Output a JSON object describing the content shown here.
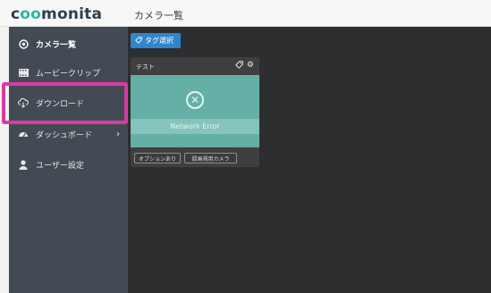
{
  "header": {
    "logo_prefix": "c",
    "logo_oo": "oo",
    "logo_suffix": "monita",
    "page_title": "カメラ一覧"
  },
  "sidebar": {
    "items": [
      {
        "label": "カメラ一覧",
        "icon": "camera-circle-icon",
        "active": true
      },
      {
        "label": "ムービークリップ",
        "icon": "film-icon"
      },
      {
        "label": "ダウンロード",
        "icon": "cloud-download-icon"
      },
      {
        "label": "ダッシュボード",
        "icon": "dashboard-icon",
        "chevron": "›"
      },
      {
        "label": "ユーザー設定",
        "icon": "user-icon"
      }
    ]
  },
  "toolbar": {
    "tag_select_label": "タグ選択",
    "tag_icon": "⌂"
  },
  "camera_card": {
    "title": "テスト",
    "tag_icon": "◇",
    "gear_icon": "⚙",
    "error_symbol": "✕",
    "error_text": "Network Error",
    "chips": [
      "オプションあり",
      "録画視用カメラ"
    ]
  },
  "colors": {
    "sidebar_bg": "#434a54",
    "main_bg": "#2d2e30",
    "accent_teal": "#64b0a7",
    "button_blue": "#2f86c9",
    "highlight_magenta": "#d63ca2"
  }
}
